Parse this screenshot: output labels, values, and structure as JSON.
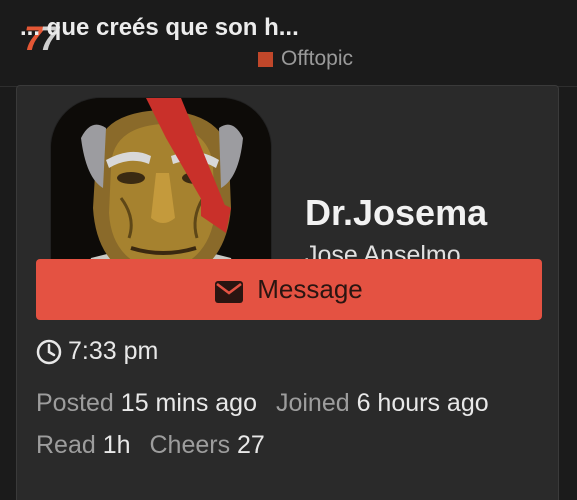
{
  "topic": {
    "title": "... que creés que son h...",
    "category": "Offtopic",
    "category_color": "#c0472a"
  },
  "user_card": {
    "username": "Dr.Josema",
    "full_name": "Jose Anselmo",
    "message_button": {
      "label": "Message",
      "icon": "envelope-icon",
      "color": "#e45242"
    },
    "local_time": {
      "icon": "clock-icon",
      "value": "7:33 pm"
    },
    "stats": {
      "posted": {
        "label": "Posted",
        "value": "15 mins ago"
      },
      "joined": {
        "label": "Joined",
        "value": "6 hours ago"
      },
      "read": {
        "label": "Read",
        "value": "1h"
      },
      "cheers": {
        "label": "Cheers",
        "value": "27"
      }
    }
  }
}
